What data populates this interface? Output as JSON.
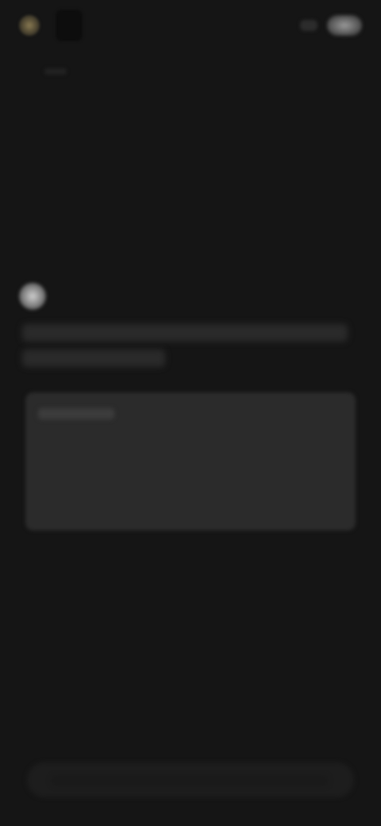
{
  "header": {
    "logo_icon": "app-logo-icon",
    "app_name": "",
    "menu_icon": "menu-icon",
    "avatar_icon": "user-avatar-icon"
  },
  "conversation": {
    "assistant_icon": "assistant-avatar-icon",
    "message_text": "",
    "card_title": ""
  },
  "composer": {
    "placeholder": ""
  },
  "colors": {
    "background": "#151515",
    "card": "#2b2b2b",
    "accent": "#8a7a52"
  }
}
